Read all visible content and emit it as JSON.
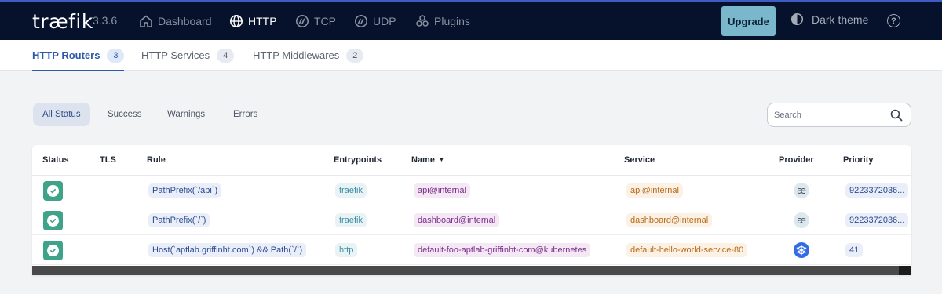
{
  "app": {
    "logo": "træfik",
    "version": "3.3.6"
  },
  "nav": [
    {
      "label": "Dashboard",
      "icon": "home-icon"
    },
    {
      "label": "HTTP",
      "icon": "globe-icon"
    },
    {
      "label": "TCP",
      "icon": "tcp-icon"
    },
    {
      "label": "UDP",
      "icon": "udp-icon"
    },
    {
      "label": "Plugins",
      "icon": "plugins-icon"
    }
  ],
  "header": {
    "upgrade": "Upgrade",
    "theme": "Dark theme",
    "help": "?"
  },
  "subnav": [
    {
      "label": "HTTP Routers",
      "count": "3"
    },
    {
      "label": "HTTP Services",
      "count": "4"
    },
    {
      "label": "HTTP Middlewares",
      "count": "2"
    }
  ],
  "filters": [
    "All Status",
    "Success",
    "Warnings",
    "Errors"
  ],
  "search": {
    "placeholder": "Search"
  },
  "table": {
    "columns": [
      "Status",
      "TLS",
      "Rule",
      "Entrypoints",
      "Name",
      "Service",
      "Provider",
      "Priority"
    ],
    "rows": [
      {
        "status": "success",
        "rule": "PathPrefix(`/api`)",
        "entrypoints": "traefik",
        "name": "api@internal",
        "service": "api@internal",
        "provider": "internal",
        "priority": "9223372036..."
      },
      {
        "status": "success",
        "rule": "PathPrefix(`/`)",
        "entrypoints": "traefik",
        "name": "dashboard@internal",
        "service": "dashboard@internal",
        "provider": "internal",
        "priority": "9223372036..."
      },
      {
        "status": "success",
        "rule": "Host(`aptlab.griffinht.com`) && Path(`/`)",
        "entrypoints": "http",
        "name": "default-foo-aptlab-griffinht-com@kubernetes",
        "service": "default-hello-world-service-80",
        "provider": "kubernetes",
        "priority": "41"
      }
    ]
  },
  "colors": {
    "topbar": "#06122b",
    "accent": "#2f5aa8",
    "upgrade": "#7bb7cc",
    "success": "#3ea388"
  }
}
